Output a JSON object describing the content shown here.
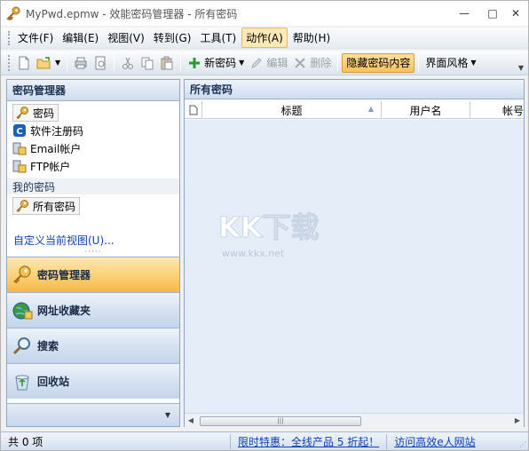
{
  "window": {
    "title": "MyPwd.epmw - 效能密码管理器 - 所有密码",
    "controls": [
      "minimize",
      "maximize",
      "close"
    ]
  },
  "menu": {
    "items": [
      {
        "label": "文件(F)"
      },
      {
        "label": "编辑(E)"
      },
      {
        "label": "视图(V)"
      },
      {
        "label": "转到(G)"
      },
      {
        "label": "工具(T)"
      },
      {
        "label": "动作(A)",
        "active": true
      },
      {
        "label": "帮助(H)"
      }
    ]
  },
  "toolbar": {
    "new_password": "新密码",
    "edit": "编辑",
    "delete": "删除",
    "hide_content": "隐藏密码内容",
    "skin": "界面风格"
  },
  "left_pane": {
    "header": "密码管理器",
    "items": [
      {
        "label": "密码",
        "icon": "key-icon"
      },
      {
        "label": "软件注册码",
        "icon": "software-c-icon"
      },
      {
        "label": "Email帐户",
        "icon": "email-account-icon"
      },
      {
        "label": "FTP帐户",
        "icon": "ftp-account-icon"
      }
    ],
    "group_label": "我的密码",
    "my_items": [
      {
        "label": "所有密码",
        "icon": "key-icon"
      }
    ],
    "custom_view": "自定义当前视图(U)..."
  },
  "nav": {
    "buttons": [
      {
        "label": "密码管理器",
        "icon": "key-icon",
        "active": true
      },
      {
        "label": "网址收藏夹",
        "icon": "globe-icon"
      },
      {
        "label": "搜索",
        "icon": "magnifier-icon"
      },
      {
        "label": "回收站",
        "icon": "recycle-bin-icon"
      }
    ]
  },
  "right_pane": {
    "header": "所有密码",
    "columns": [
      "标题",
      "用户名",
      "帐号"
    ],
    "watermark": "KK下载",
    "watermark_url": "www.kkx.net"
  },
  "status": {
    "count": "共 0 项",
    "promo": "限时特惠：全线产品 5 折起！",
    "site": "访问高效e人网站"
  },
  "colors": {
    "accent_orange": "#f7b84a",
    "pane_header_blue": "#cfdcee",
    "link": "#1140b5"
  }
}
